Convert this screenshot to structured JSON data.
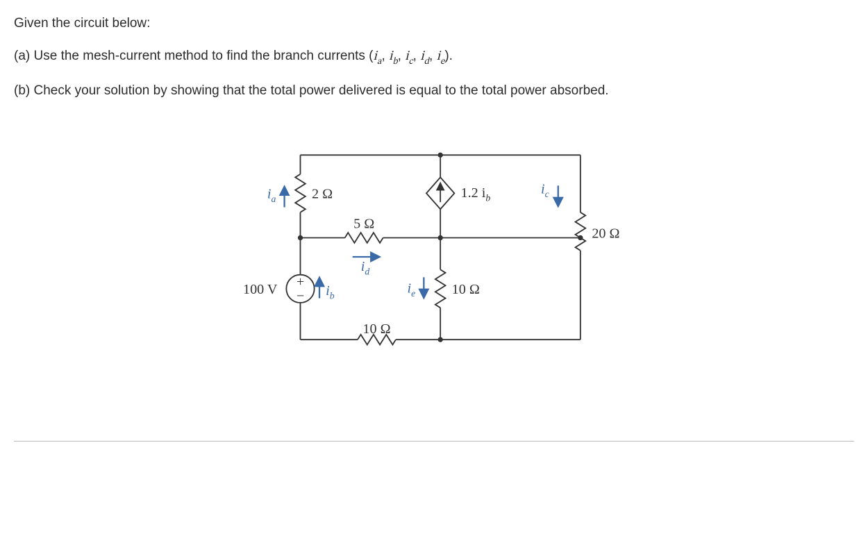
{
  "text": {
    "intro": "Given the circuit below:",
    "partA_pre": "(a) Use the mesh-current method to find the branch currents (",
    "partA_post": ").",
    "partB": "(b) Check your solution by showing that the total power delivered is equal to the total power absorbed."
  },
  "currents": {
    "ia": "i",
    "ia_sub": "a",
    "ib": "i",
    "ib_sub": "b",
    "ic": "i",
    "ic_sub": "c",
    "id": "i",
    "id_sub": "d",
    "ie": "i",
    "ie_sub": "e"
  },
  "circuit": {
    "source_v": "100 V",
    "r_2": "2 Ω",
    "r_5": "5 Ω",
    "r_10a": "10 Ω",
    "r_10b": "10 Ω",
    "r_20": "20 Ω",
    "ccs": "1.2 i",
    "ccs_sub": "b",
    "ia": "i",
    "ia_sub": "a",
    "ib": "i",
    "ib_sub": "b",
    "ic": "i",
    "ic_sub": "c",
    "id": "i",
    "id_sub": "d",
    "ie": "i",
    "ie_sub": "e"
  },
  "chart_data": {
    "type": "circuit-schematic",
    "nodes": [
      "top",
      "mid-left",
      "mid-right",
      "bottom"
    ],
    "sources": [
      {
        "kind": "independent-voltage",
        "value": 100,
        "unit": "V",
        "polarity": "+ up",
        "between": [
          "mid-left",
          "bottom"
        ]
      },
      {
        "kind": "dependent-current",
        "expression": "1.2*i_b",
        "direction": "up",
        "between": [
          "mid-right",
          "top"
        ]
      }
    ],
    "resistors": [
      {
        "value": 2,
        "unit": "Ω",
        "between": [
          "top",
          "mid-left"
        ],
        "current_label": "i_a (up)"
      },
      {
        "value": 5,
        "unit": "Ω",
        "between": [
          "mid-left",
          "mid-right"
        ],
        "current_label": "i_d (right)"
      },
      {
        "value": 10,
        "unit": "Ω",
        "between": [
          "mid-right",
          "bottom"
        ],
        "current_label": "i_e (down)"
      },
      {
        "value": 10,
        "unit": "Ω",
        "between": [
          "mid-left",
          "bottom"
        ],
        "series_path": "bottom-rail"
      },
      {
        "value": 20,
        "unit": "Ω",
        "between": [
          "top",
          "mid-right"
        ],
        "right_branch": true,
        "current_label": "i_c (down)"
      }
    ],
    "branch_currents": [
      "i_a",
      "i_b",
      "i_c",
      "i_d",
      "i_e"
    ]
  }
}
